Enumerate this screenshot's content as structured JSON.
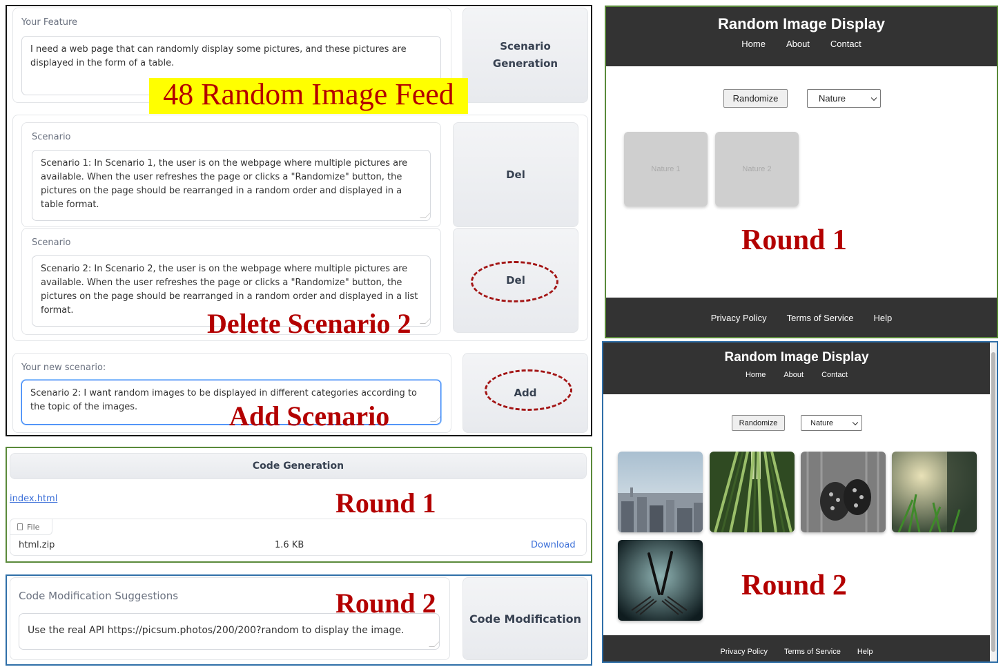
{
  "banner": {
    "title": "48 Random Image Feed"
  },
  "feature": {
    "label": "Your Feature",
    "value": "I need a web page that can randomly display some pictures, and these pictures are displayed in the form of a table.",
    "button": "Scenario Generation"
  },
  "scenarios": [
    {
      "label": "Scenario",
      "value": "Scenario 1: In Scenario 1, the user is on the webpage where multiple pictures are available. When the user refreshes the page or clicks a \"Randomize\" button, the pictures on the page should be rearranged in a random order and displayed in a table format.",
      "button": "Del"
    },
    {
      "label": "Scenario",
      "value": "Scenario 2:  In Scenario 2, the user is on the webpage where multiple pictures are available. When the user refreshes the page or clicks a \"Randomize\" button, the pictures on the page should be rearranged in a random order and displayed in a list format.",
      "button": "Del"
    }
  ],
  "new_scenario": {
    "label": "Your new scenario:",
    "value": "Scenario 2:  I want random images to be displayed in different categories according to the topic of the images.",
    "button": "Add"
  },
  "annotations": {
    "delete": "Delete Scenario 2",
    "add": "Add Scenario",
    "round1": "Round 1",
    "round2": "Round 2"
  },
  "code_generation": {
    "button": "Code Generation",
    "link": "index.html",
    "file_tab": "File",
    "file_name": "html.zip",
    "file_size": "1.6 KB",
    "download": "Download"
  },
  "code_modification": {
    "label": "Code Modification Suggestions",
    "value": "Use the real API https://picsum.photos/200/200?random to display the image.",
    "button": "Code Modification"
  },
  "site": {
    "title": "Random Image Display",
    "nav": [
      "Home",
      "About",
      "Contact"
    ],
    "randomize": "Randomize",
    "category": "Nature",
    "footer": [
      "Privacy Policy",
      "Terms of Service",
      "Help"
    ]
  },
  "round1_tiles": [
    "Nature 1",
    "Nature 2"
  ],
  "colors": {
    "accent_red": "#b30000",
    "banner_yellow": "#ffff00",
    "frame_green": "#5a8a3a",
    "frame_blue": "#2f6fa8",
    "site_dark": "#333333"
  }
}
